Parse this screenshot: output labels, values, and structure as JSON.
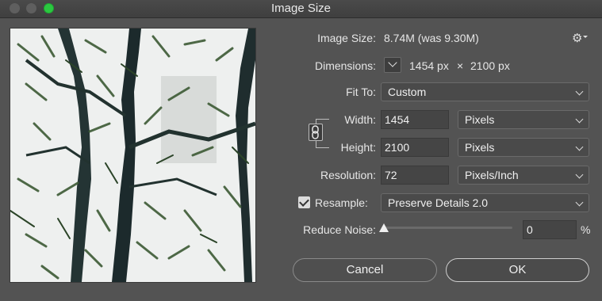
{
  "window": {
    "title": "Image Size"
  },
  "image_size": {
    "label": "Image Size:",
    "value": "8.74M (was 9.30M)"
  },
  "dimensions": {
    "label": "Dimensions:",
    "width": "1454 px",
    "times": "×",
    "height": "2100 px"
  },
  "fit_to": {
    "label": "Fit To:",
    "value": "Custom"
  },
  "width": {
    "label": "Width:",
    "value": "1454",
    "unit": "Pixels"
  },
  "height": {
    "label": "Height:",
    "value": "2100",
    "unit": "Pixels"
  },
  "resolution": {
    "label": "Resolution:",
    "value": "72",
    "unit": "Pixels/Inch"
  },
  "resample": {
    "label": "Resample:",
    "checked": true,
    "value": "Preserve Details 2.0"
  },
  "reduce_noise": {
    "label": "Reduce Noise:",
    "value": "0",
    "unit": "%",
    "fraction": 0
  },
  "buttons": {
    "cancel": "Cancel",
    "ok": "OK"
  },
  "icons": {
    "settings": "gear-icon",
    "dimensions_toggle": "chevron-down-icon",
    "constrain": "chain-link-icon",
    "check": "checkmark-icon"
  },
  "colors": {
    "zoom_button": "#2bc840",
    "dialog_bg": "#535353"
  }
}
